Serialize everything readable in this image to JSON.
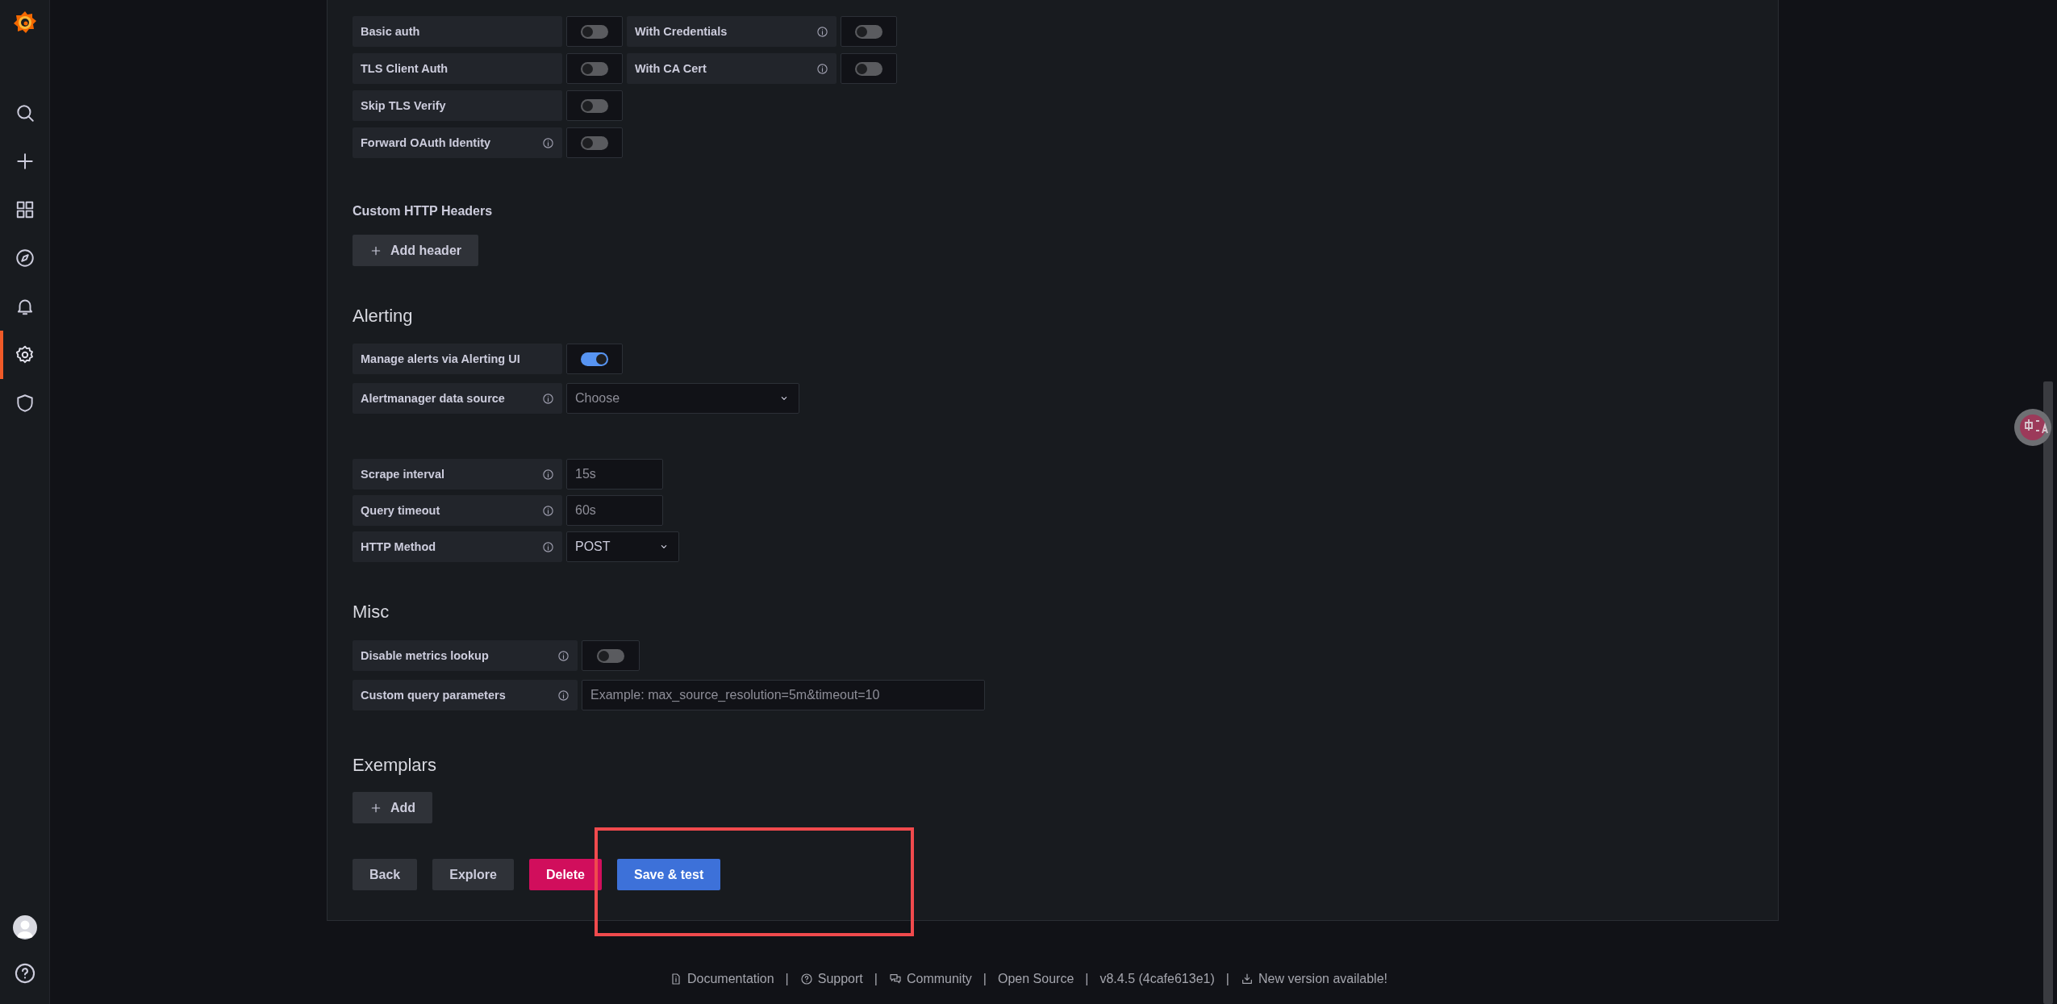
{
  "sidebar": {
    "items": [
      {
        "kind": "search",
        "selected": false
      },
      {
        "kind": "create",
        "selected": false
      },
      {
        "kind": "dashboards",
        "selected": false
      },
      {
        "kind": "explore",
        "selected": false
      },
      {
        "kind": "alerting",
        "selected": false
      },
      {
        "kind": "configuration",
        "selected": true
      },
      {
        "kind": "admin",
        "selected": false
      }
    ],
    "bottom_items": [
      {
        "kind": "profile"
      },
      {
        "kind": "help"
      }
    ]
  },
  "auth": {
    "rows": [
      [
        {
          "label": "Basic auth",
          "info": false,
          "on": false
        },
        {
          "label": "With Credentials",
          "info": true,
          "on": false
        }
      ],
      [
        {
          "label": "TLS Client Auth",
          "info": false,
          "on": false
        },
        {
          "label": "With CA Cert",
          "info": true,
          "on": false
        }
      ],
      [
        {
          "label": "Skip TLS Verify",
          "info": false,
          "on": false
        }
      ],
      [
        {
          "label": "Forward OAuth Identity",
          "info": true,
          "on": false
        }
      ]
    ]
  },
  "custom_headers": {
    "title": "Custom HTTP Headers",
    "button": "Add header"
  },
  "alerting": {
    "title": "Alerting",
    "fields": [
      {
        "kind": "toggle",
        "label": "Manage alerts via Alerting UI",
        "info": false,
        "on": true
      },
      {
        "kind": "select",
        "label": "Alertmanager data source",
        "info": true,
        "placeholder": "Choose"
      }
    ]
  },
  "query_settings": {
    "fields": [
      {
        "kind": "input",
        "label": "Scrape interval",
        "info": true,
        "placeholder": "15s"
      },
      {
        "kind": "input",
        "label": "Query timeout",
        "info": true,
        "placeholder": "60s"
      },
      {
        "kind": "select",
        "label": "HTTP Method",
        "info": true,
        "value": "POST"
      }
    ]
  },
  "misc": {
    "title": "Misc",
    "fields": [
      {
        "kind": "toggle",
        "label": "Disable metrics lookup",
        "info": true,
        "on": false
      },
      {
        "kind": "input",
        "label": "Custom query parameters",
        "info": true,
        "placeholder": "Example: max_source_resolution=5m&timeout=10"
      }
    ]
  },
  "exemplars": {
    "title": "Exemplars",
    "button": "Add"
  },
  "actions": [
    {
      "label": "Back",
      "kind": "secondary"
    },
    {
      "label": "Explore",
      "kind": "secondary"
    },
    {
      "label": "Delete",
      "kind": "destructive"
    },
    {
      "label": "Save & test",
      "kind": "primary"
    }
  ],
  "footer": {
    "links": [
      {
        "kind": "document",
        "label": "Documentation"
      },
      {
        "kind": "separator",
        "label": "|"
      },
      {
        "kind": "support",
        "label": "Support"
      },
      {
        "kind": "separator",
        "label": "|"
      },
      {
        "kind": "community",
        "label": "Community"
      },
      {
        "kind": "separator",
        "label": "|"
      },
      {
        "kind": "plain",
        "label": "Open Source"
      },
      {
        "kind": "separator",
        "label": "|"
      },
      {
        "kind": "plain",
        "label": "v8.4.5 (4cafe613e1)"
      },
      {
        "kind": "separator",
        "label": "|"
      },
      {
        "kind": "download",
        "label": "New version available!"
      }
    ]
  }
}
